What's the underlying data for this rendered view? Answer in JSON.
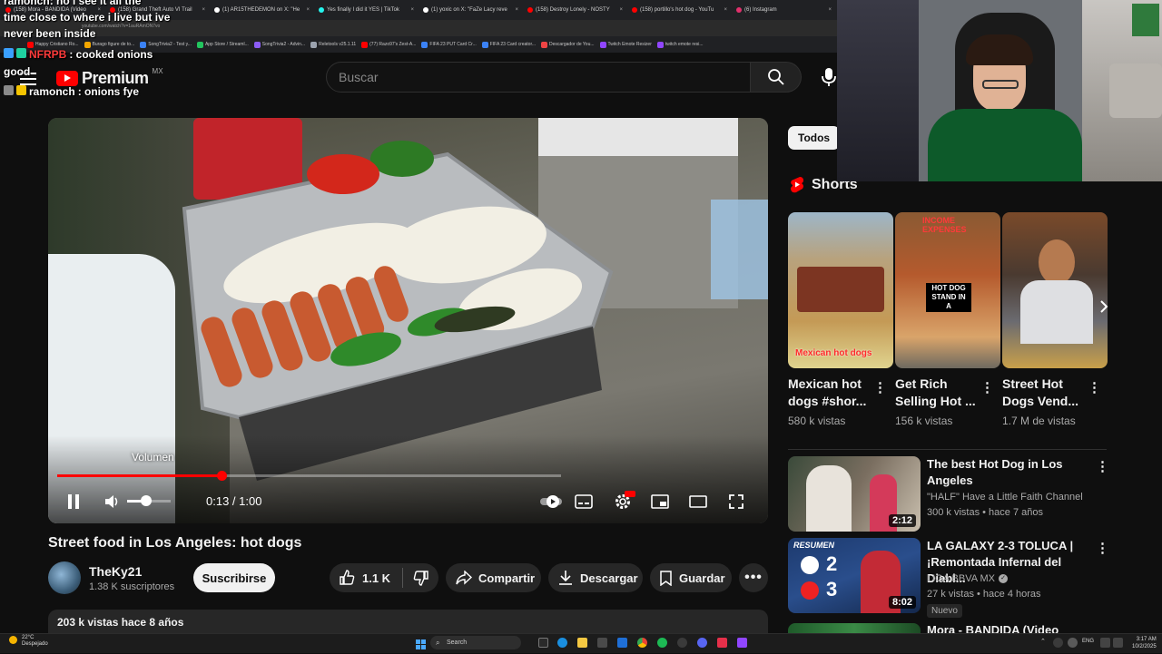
{
  "browser": {
    "tabs": [
      {
        "label": "(158) Mora - BANDIDA (Video",
        "color": "#ff0000"
      },
      {
        "label": "(158) Grand Theft Auto VI Trail",
        "color": "#ff0000"
      },
      {
        "label": "(1) AR15THEDEMON on X: \"He",
        "color": "#ffffff"
      },
      {
        "label": "Yes finally I did it YES | TikTok",
        "color": "#25f4ee"
      },
      {
        "label": "(1) yoxic on X: \"FaZe Lacy reve",
        "color": "#ffffff"
      },
      {
        "label": "(158) Destroy Lonely - NOSTY",
        "color": "#ff0000"
      },
      {
        "label": "(158) portillo's hot dog - YouTu",
        "color": "#ff0000"
      },
      {
        "label": "(6) Instagram",
        "color": "#e1306c"
      }
    ],
    "url": "youtube.com/watch?v=1auRAmON7vo",
    "bookmarks": [
      {
        "label": "Happy Cristiano Ro...",
        "color": "#ff0000"
      },
      {
        "label": "Burago figure de to...",
        "color": "#f4a700"
      },
      {
        "label": "SongTrivia2 - Test y...",
        "color": "#3b82f6"
      },
      {
        "label": "App Store / Streaml...",
        "color": "#22c55e"
      },
      {
        "label": "SongTrivia2 - Advin...",
        "color": "#8b5cf6"
      },
      {
        "label": "Reletools v25.1.11",
        "color": "#9ca3af"
      },
      {
        "label": "(77) Razo97's Zest-A...",
        "color": "#ff0000"
      },
      {
        "label": "FIFA 23 PUT Card Cr...",
        "color": "#3b82f6"
      },
      {
        "label": "FIFA 23 Card creator...",
        "color": "#3b82f6"
      },
      {
        "label": "Descargador de You...",
        "color": "#ef4444"
      },
      {
        "label": "Twitch Emote Resizer",
        "color": "#9146ff"
      },
      {
        "label": "twitch emote resi...",
        "color": "#9146ff"
      }
    ]
  },
  "chat": [
    {
      "user": "ramonch",
      "text": ": no i see it all the",
      "user_color": "white"
    },
    {
      "user": "",
      "text": "time close to where i live but ive",
      "user_color": "white"
    },
    {
      "user": "",
      "text": "never been inside",
      "user_color": "white"
    },
    {
      "user": "NFRPB",
      "text": ": cooked onions",
      "user_color": "red"
    },
    {
      "user": "",
      "text": "good",
      "user_color": "white"
    },
    {
      "user": "ramonch",
      "text": ": onions fye",
      "user_color": "white"
    }
  ],
  "header": {
    "logo_word": "Premium",
    "region": "MX",
    "search_placeholder": "Buscar"
  },
  "player": {
    "volume_tooltip": "Volumen",
    "current_time": "0:13 / 1:00",
    "progress": 0.327
  },
  "video": {
    "title": "Street food in Los Angeles: hot dogs",
    "channel": "TheKy21",
    "subscribers": "1.38 K suscriptores",
    "subscribe_label": "Suscribirse",
    "likes": "1.1 K",
    "share_label": "Compartir",
    "download_label": "Descargar",
    "save_label": "Guardar",
    "views_date": "203 k vistas  hace 8 años"
  },
  "sidebar": {
    "chip": "Todos",
    "shorts_heading": "Shorts",
    "shorts": [
      {
        "title": "Mexican hot dogs #shor...",
        "views": "580 k vistas",
        "overlay": "Mexican hot dogs"
      },
      {
        "title": "Get Rich Selling Hot ...",
        "views": "156 k vistas",
        "overlay": "HOT DOG STAND IN A",
        "top_overlay": "INCOME  EXPENSES"
      },
      {
        "title": "Street Hot Dogs Vend...",
        "views": "1.7 M de vistas",
        "overlay": ""
      }
    ],
    "related": [
      {
        "title": "The best Hot Dog in Los Angeles",
        "channel": "\"HALF\" Have a Little Faith Channel",
        "meta": "300 k vistas • hace 7 años",
        "duration": "2:12"
      },
      {
        "title": "LA GALAXY 2-3 TOLUCA | ¡Remontada Infernal del Diabl...",
        "channel": "LIGA BBVA MX",
        "meta": "27 k vistas • hace 4 horas",
        "duration": "8:02",
        "badge": "Nuevo",
        "thumb_label": "RESUMEN",
        "score_a": "2",
        "score_b": "3"
      },
      {
        "title": "Mora - BANDIDA (Video Oficial)",
        "channel": "",
        "meta": "",
        "duration": ""
      }
    ]
  },
  "taskbar": {
    "weather_temp": "22°C",
    "weather_desc": "Despejado",
    "search_label": "Search",
    "lang": "ENG",
    "time": "3:17 AM",
    "date": "10/2/2025"
  }
}
